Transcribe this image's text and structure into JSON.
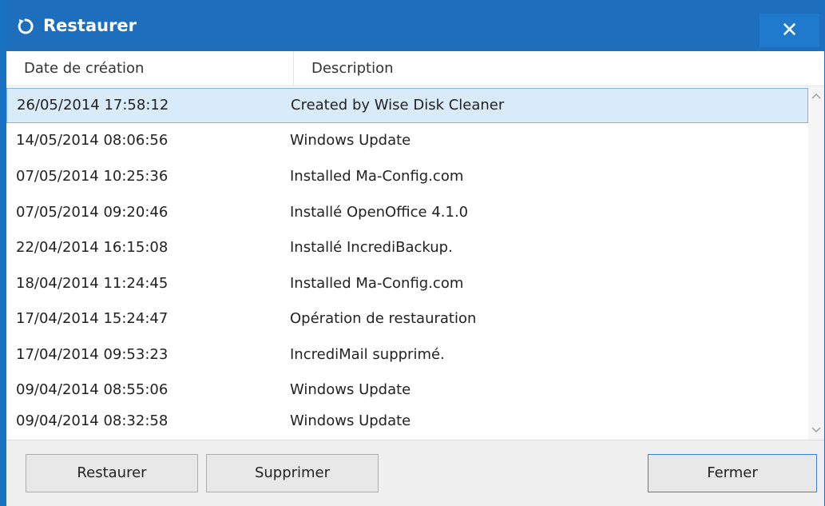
{
  "window": {
    "title": "Restaurer",
    "close_glyph": "✕",
    "accent": "#1d6fbd"
  },
  "columns": {
    "date": "Date de création",
    "description": "Description"
  },
  "rows": [
    {
      "date": "26/05/2014 17:58:12",
      "description": "Created by Wise Disk Cleaner",
      "selected": true
    },
    {
      "date": "14/05/2014 08:06:56",
      "description": "Windows Update"
    },
    {
      "date": "07/05/2014 10:25:36",
      "description": "Installed Ma-Config.com"
    },
    {
      "date": "07/05/2014 09:20:46",
      "description": "Installé OpenOffice 4.1.0"
    },
    {
      "date": "22/04/2014 16:15:08",
      "description": "Installé IncrediBackup."
    },
    {
      "date": "18/04/2014 11:24:45",
      "description": "Installed Ma-Config.com"
    },
    {
      "date": "17/04/2014 15:24:47",
      "description": "Opération de restauration"
    },
    {
      "date": "17/04/2014 09:53:23",
      "description": "IncrediMail supprimé."
    },
    {
      "date": "09/04/2014 08:55:06",
      "description": "Windows Update"
    },
    {
      "date": "09/04/2014 08:32:58",
      "description": "Windows Update"
    }
  ],
  "buttons": {
    "restore": "Restaurer",
    "delete": "Supprimer",
    "close": "Fermer"
  },
  "icons": {
    "title": "restore-arrow-icon",
    "close": "close-icon",
    "scroll_up": "chevron-up-icon",
    "scroll_down": "chevron-down-icon"
  }
}
